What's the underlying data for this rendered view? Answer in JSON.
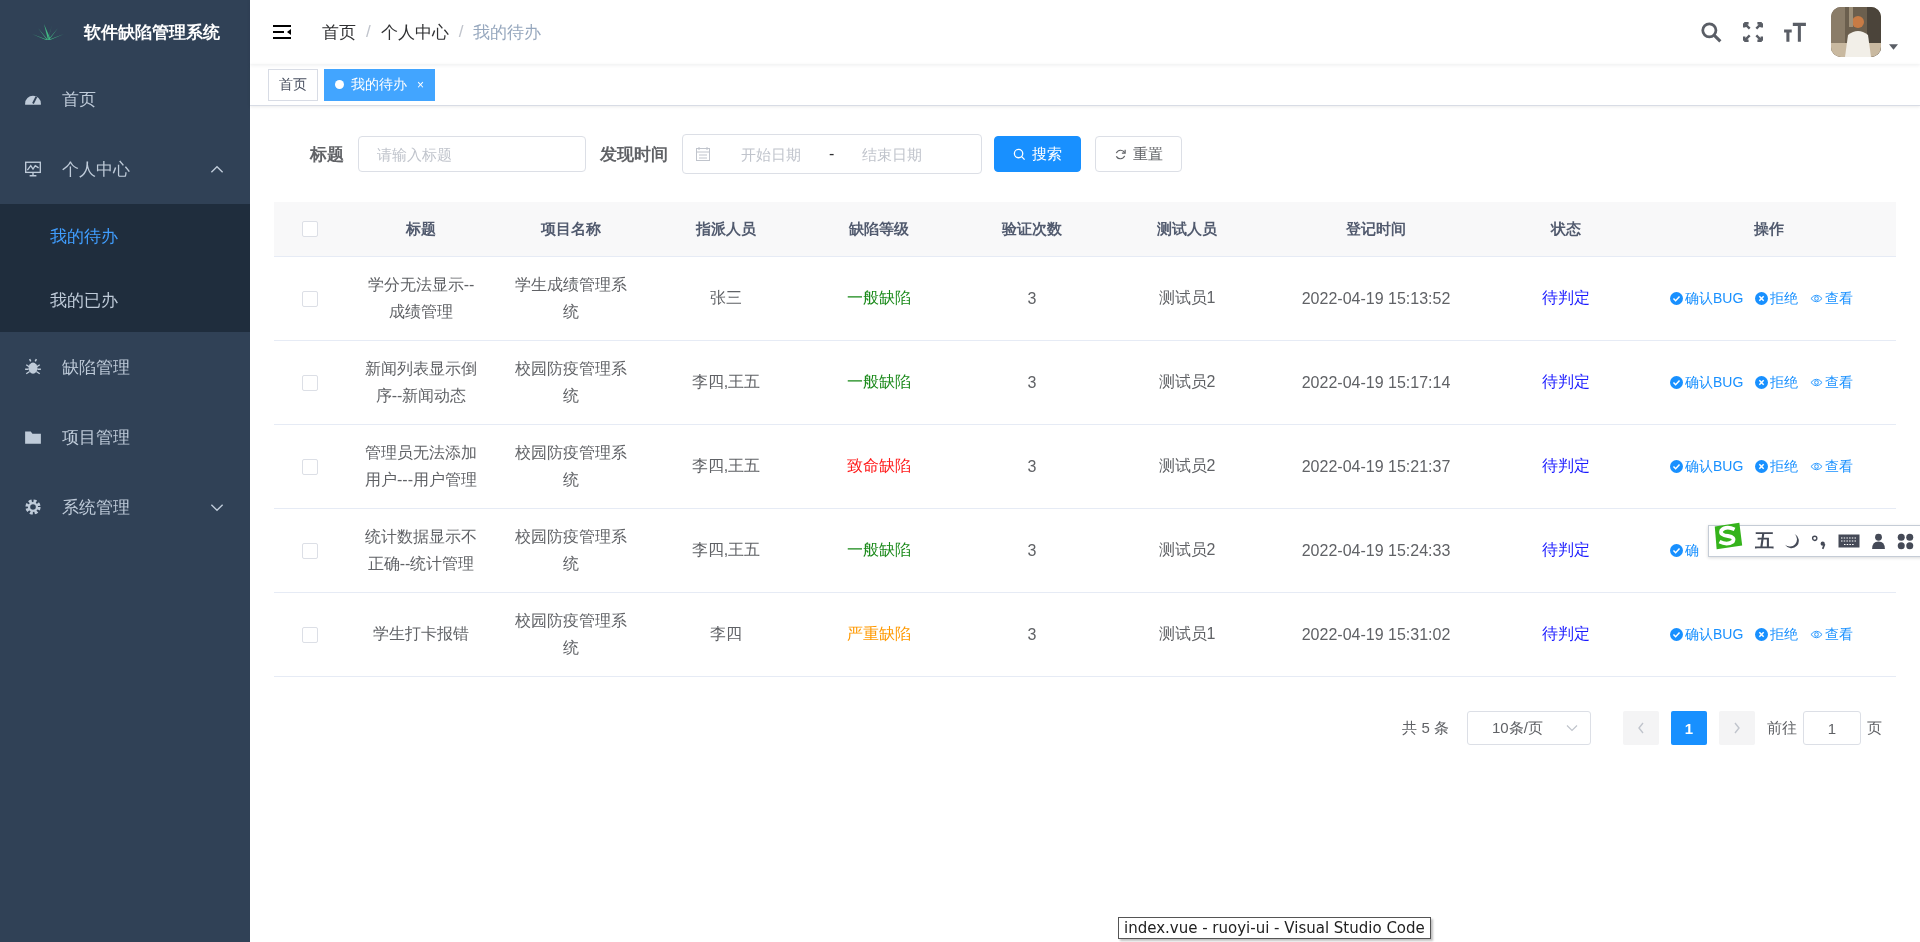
{
  "sidebar": {
    "title": "软件缺陷管理系统",
    "items": [
      {
        "label": "首页"
      },
      {
        "label": "个人中心",
        "expanded": true,
        "children": [
          {
            "label": "我的待办",
            "selected": true
          },
          {
            "label": "我的已办",
            "selected": false
          }
        ]
      },
      {
        "label": "缺陷管理"
      },
      {
        "label": "项目管理"
      },
      {
        "label": "系统管理",
        "expanded": false
      }
    ]
  },
  "breadcrumb": {
    "separator": "/",
    "items": [
      "首页",
      "个人中心",
      "我的待办"
    ]
  },
  "tags": [
    {
      "label": "首页",
      "selected": false
    },
    {
      "label": "我的待办",
      "selected": true,
      "close": "×"
    }
  ],
  "search": {
    "title_label": "标题",
    "title_placeholder": "请输入标题",
    "date_label": "发现时间",
    "start_placeholder": "开始日期",
    "range_separator": "-",
    "end_placeholder": "结束日期",
    "search_button": "搜索",
    "reset_button": "重置"
  },
  "table": {
    "all_checked": false,
    "columns": [
      "标题",
      "项目名称",
      "指派人员",
      "缺陷等级",
      "验证次数",
      "测试人员",
      "登记时间",
      "状态",
      "操作"
    ],
    "rows": [
      {
        "checked": false,
        "title": "学分无法显示--成绩管理",
        "project": "学生成绩管理系统",
        "assignee": "张三",
        "level": "一般缺陷",
        "color": "#1b8a1b",
        "count": "3",
        "tester": "测试员1",
        "time": "2022-04-19 15:13:52",
        "status": "待判定",
        "actions": [
          {
            "kind": "confirm",
            "label": "确认BUG"
          },
          {
            "kind": "reject",
            "label": "拒绝"
          },
          {
            "kind": "view",
            "label": "查看"
          }
        ]
      },
      {
        "checked": false,
        "title": "新闻列表显示倒序--新闻动态",
        "project": "校园防疫管理系统",
        "assignee": "李四,王五",
        "level": "一般缺陷",
        "color": "#1b8a1b",
        "count": "3",
        "tester": "测试员2",
        "time": "2022-04-19 15:17:14",
        "status": "待判定",
        "actions": [
          {
            "kind": "confirm",
            "label": "确认BUG"
          },
          {
            "kind": "reject",
            "label": "拒绝"
          },
          {
            "kind": "view",
            "label": "查看"
          }
        ]
      },
      {
        "checked": false,
        "title": "管理员无法添加用户---用户管理",
        "project": "校园防疫管理系统",
        "assignee": "李四,王五",
        "level": "致命缺陷",
        "color": "#ff1a1a",
        "count": "3",
        "tester": "测试员2",
        "time": "2022-04-19 15:21:37",
        "status": "待判定",
        "actions": [
          {
            "kind": "confirm",
            "label": "确认BUG"
          },
          {
            "kind": "reject",
            "label": "拒绝"
          },
          {
            "kind": "view",
            "label": "查看"
          }
        ]
      },
      {
        "checked": false,
        "title": "统计数据显示不正确--统计管理",
        "project": "校园防疫管理系统",
        "assignee": "李四,王五",
        "level": "一般缺陷",
        "color": "#1b8a1b",
        "count": "3",
        "tester": "测试员2",
        "time": "2022-04-19 15:24:33",
        "status": "待判定",
        "actions": [
          {
            "kind": "confirm",
            "label": "确"
          }
        ]
      },
      {
        "checked": false,
        "title": "学生打卡报错",
        "project": "校园防疫管理系统",
        "assignee": "李四",
        "level": "严重缺陷",
        "color": "#ff9900",
        "count": "3",
        "tester": "测试员1",
        "time": "2022-04-19 15:31:02",
        "status": "待判定",
        "actions": [
          {
            "kind": "confirm",
            "label": "确认BUG"
          },
          {
            "kind": "reject",
            "label": "拒绝"
          },
          {
            "kind": "view",
            "label": "查看"
          }
        ]
      }
    ]
  },
  "pagination": {
    "total": "共 5 条",
    "page_size": "10条/页",
    "pages": [
      {
        "label": "1",
        "selected": true
      }
    ],
    "goto_label": "前往",
    "goto_value": "1",
    "goto_unit": "页"
  },
  "ime_toolbar": {
    "mode": "五"
  },
  "taskbar_tooltip": "index.vue - ruoyi-ui - Visual Studio Code"
}
